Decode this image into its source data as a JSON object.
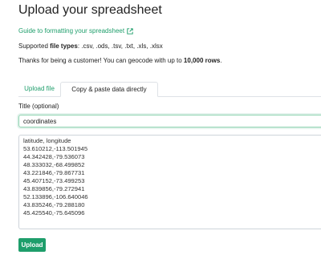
{
  "page": {
    "title": "Upload your spreadsheet",
    "guide_link": "Guide to formatting your spreadsheet",
    "supported_prefix": "Supported ",
    "supported_bold": "file types",
    "supported_suffix": ": .csv, .ods, .tsv, .txt, .xls, .xlsx",
    "thanks_prefix": "Thanks for being a customer! You can geocode with up to ",
    "thanks_bold": "10,000 rows",
    "thanks_suffix": "."
  },
  "tabs": {
    "upload_file": "Upload file",
    "paste_data": "Copy & paste data directly"
  },
  "form": {
    "title_label": "Title (optional)",
    "title_value": "coordinates",
    "data_lines": [
      "latitude, longitude",
      "53.610212,-113.501945",
      "44.342428,-79.536073",
      "48.333032,-68.499852",
      "43.221846,-79.867731",
      "45.407152,-73.499253",
      "43.839856,-79.272941",
      "52.133896,-106.640046",
      "43.835246,-79.288180",
      "45.425540,-75.645096"
    ],
    "upload_button": "Upload"
  },
  "icons": {
    "external_link": "external-link-icon"
  },
  "colors": {
    "accent": "#1e9e6b"
  }
}
